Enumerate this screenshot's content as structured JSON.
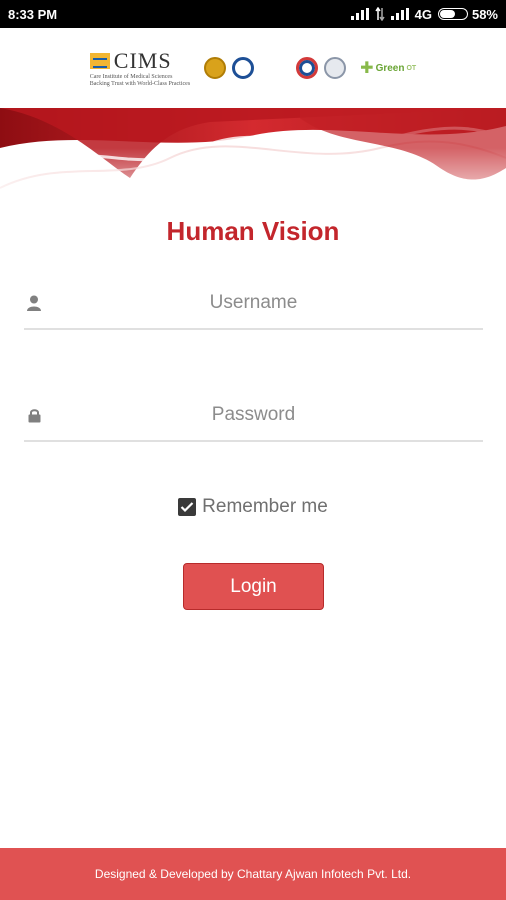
{
  "status_bar": {
    "time": "8:33 PM",
    "network": "4G",
    "battery": "58%",
    "battery_level": 0.58
  },
  "logos": {
    "cims_name": "CIMS",
    "cims_tagline": "Care Institute of Medical Sciences",
    "cims_motto": "Backing Trust with World-Class Practices",
    "green_logo": "Green",
    "green_logo_suffix": "OT"
  },
  "app": {
    "title": "Human Vision"
  },
  "login_form": {
    "username_placeholder": "Username",
    "password_placeholder": "Password",
    "remember_label": "Remember me",
    "remember_checked": true,
    "login_label": "Login"
  },
  "footer": {
    "credit": "Designed & Developed by Chattary Ajwan Infotech Pvt. Ltd."
  },
  "colors": {
    "brand_red": "#c3262c",
    "button_red": "#e05151",
    "footer_red": "#e05252"
  }
}
